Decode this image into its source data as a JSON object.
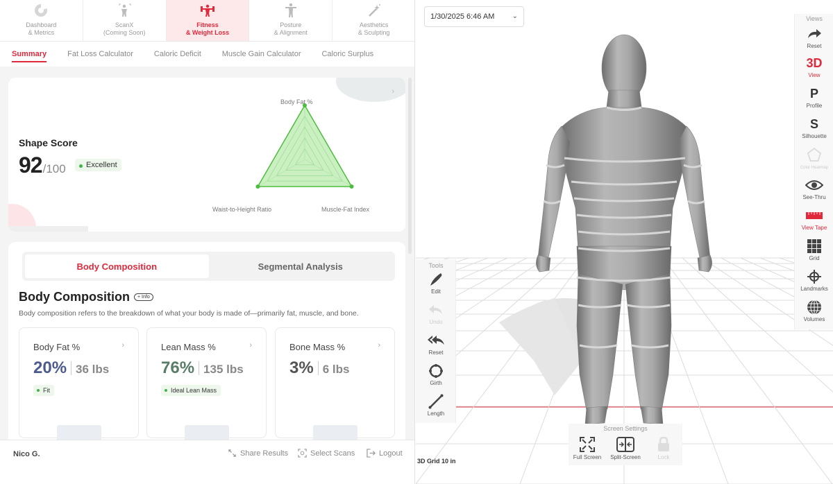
{
  "nav": {
    "tabs": [
      {
        "line1": "Dashboard",
        "line2": "& Metrics"
      },
      {
        "line1": "ScanX",
        "line2": "(Coming Soon)"
      },
      {
        "line1": "Fitness",
        "line2": "& Weight Loss"
      },
      {
        "line1": "Posture",
        "line2": "& Alignment"
      },
      {
        "line1": "Aesthetics",
        "line2": "& Sculpting"
      }
    ],
    "active_index": 2
  },
  "subnav": {
    "tabs": [
      "Summary",
      "Fat Loss Calculator",
      "Caloric Deficit",
      "Muscle Gain Calculator",
      "Caloric Surplus"
    ],
    "active_index": 0
  },
  "shape_score": {
    "title": "Shape Score",
    "score": "92",
    "max": "/100",
    "badge": "Excellent"
  },
  "radar": {
    "axes": [
      "Body Fat %",
      "Waist-to-Height Ratio",
      "Muscle-Fat Index"
    ],
    "values": [
      1.0,
      1.0,
      1.0
    ],
    "fill_color": "#9ee38f",
    "stroke_color": "#4cbd3e"
  },
  "body_composition": {
    "segments": [
      "Body Composition",
      "Segmental Analysis"
    ],
    "active_segment": 0,
    "title": "Body Composition",
    "info_label": "+ Info",
    "description": "Body composition refers to the breakdown of what your body is made of—primarily fat, muscle, and bone.",
    "metrics": [
      {
        "title": "Body Fat %",
        "percent": "20%",
        "weight": "36 lbs",
        "badge": "Fit",
        "color": "#4b5b8e"
      },
      {
        "title": "Lean Mass %",
        "percent": "76%",
        "weight": "135 lbs",
        "badge": "Ideal Lean Mass",
        "color": "#5a7d68"
      },
      {
        "title": "Bone Mass %",
        "percent": "3%",
        "weight": "6 lbs",
        "badge": "",
        "color": "#555555"
      }
    ]
  },
  "footer": {
    "user": "Nico G.",
    "share": "Share Results",
    "select": "Select Scans",
    "logout": "Logout"
  },
  "viewer": {
    "date": "1/30/2025 6:46 AM",
    "views_title": "Views",
    "views": [
      {
        "label": "Reset",
        "icon": "redo-arrow-icon",
        "glyph": ""
      },
      {
        "label": "View",
        "icon": "3d-view-icon",
        "glyph": "3D"
      },
      {
        "label": "Profile",
        "icon": "profile-icon",
        "glyph": "P"
      },
      {
        "label": "Silhouette",
        "icon": "silhouette-icon",
        "glyph": "S"
      },
      {
        "label": "Color Heatmap",
        "icon": "pentagon-icon",
        "glyph": ""
      },
      {
        "label": "See-Thru",
        "icon": "eye-icon",
        "glyph": ""
      },
      {
        "label": "View Tape",
        "icon": "tape-icon",
        "glyph": ""
      },
      {
        "label": "Grid",
        "icon": "grid-icon",
        "glyph": ""
      },
      {
        "label": "Landmarks",
        "icon": "crosshair-icon",
        "glyph": ""
      },
      {
        "label": "Volumes",
        "icon": "globe-icon",
        "glyph": ""
      }
    ],
    "tools_title": "Tools",
    "tools": [
      "Edit",
      "Undo",
      "Reset",
      "Girth",
      "Length"
    ],
    "screen_settings_title": "Screen Settings",
    "screen_settings": [
      "Full Screen",
      "Split-Screen",
      "Lock"
    ],
    "grid_label": "3D Grid 10 in",
    "accent": "#e0293b",
    "tape_color": "#e0293b"
  }
}
